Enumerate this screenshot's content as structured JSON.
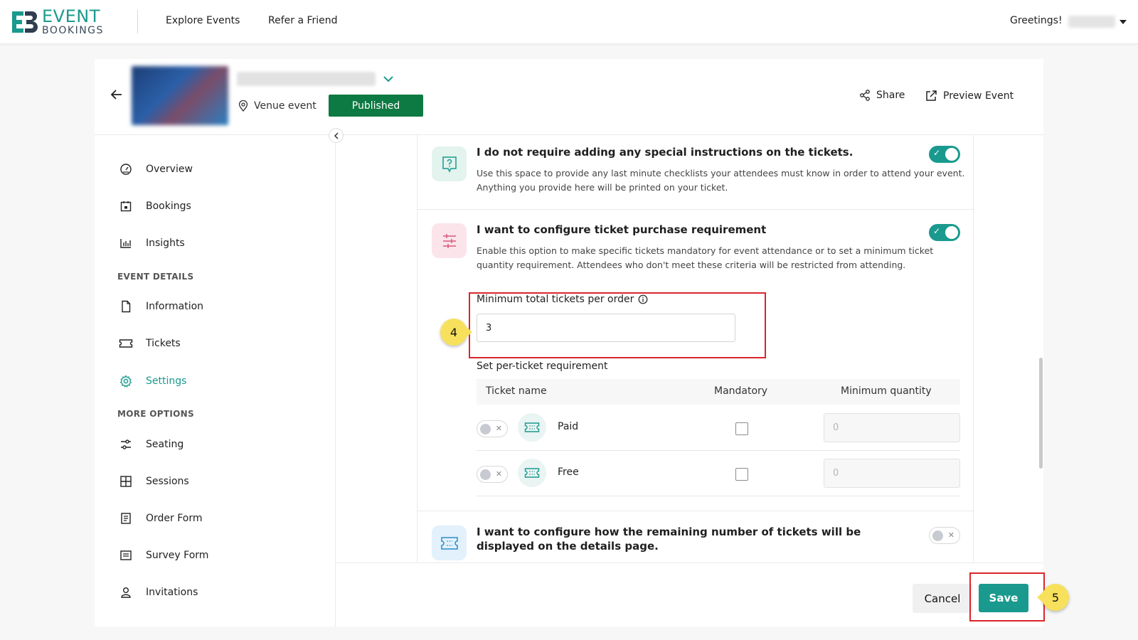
{
  "app": {
    "logo_line1": "EVENT",
    "logo_line2": "BOOKINGS"
  },
  "nav": {
    "explore": "Explore Events",
    "refer": "Refer a Friend",
    "greeting": "Greetings!"
  },
  "event": {
    "venue_type": "Venue event",
    "status": "Published",
    "share": "Share",
    "preview": "Preview Event"
  },
  "sidebar": {
    "items": [
      {
        "label": "Overview",
        "icon": "gauge-icon"
      },
      {
        "label": "Bookings",
        "icon": "calendar-icon"
      },
      {
        "label": "Insights",
        "icon": "bar-chart-icon"
      }
    ],
    "event_details_heading": "EVENT DETAILS",
    "event_details": [
      {
        "label": "Information",
        "icon": "document-icon"
      },
      {
        "label": "Tickets",
        "icon": "ticket-icon"
      },
      {
        "label": "Settings",
        "icon": "gear-icon",
        "active": true
      }
    ],
    "more_options_heading": "MORE OPTIONS",
    "more_options": [
      {
        "label": "Seating",
        "icon": "sliders-icon"
      },
      {
        "label": "Sessions",
        "icon": "grid-icon"
      },
      {
        "label": "Order Form",
        "icon": "form-icon"
      },
      {
        "label": "Survey Form",
        "icon": "survey-icon"
      },
      {
        "label": "Invitations",
        "icon": "person-icon"
      }
    ]
  },
  "settings": {
    "instructions": {
      "title": "I do not require adding any special instructions on the tickets.",
      "desc": "Use this space to provide any last minute checklists your attendees must know in order to attend your event. Anything you provide here will be printed on your ticket.",
      "enabled": true
    },
    "purchase_req": {
      "title": "I want to configure ticket purchase requirement",
      "desc": "Enable this option to make specific tickets mandatory for event attendance or to set a minimum ticket quantity requirement. Attendees who don't meet these criteria will be restricted from attending.",
      "enabled": true,
      "min_label": "Minimum total tickets per order",
      "min_value": "3",
      "per_ticket_label": "Set per-ticket requirement",
      "columns": [
        "Ticket name",
        "Mandatory",
        "Minimum quantity"
      ],
      "tickets": [
        {
          "name": "Paid",
          "enabled": false,
          "mandatory": false,
          "min_qty_placeholder": "0"
        },
        {
          "name": "Free",
          "enabled": false,
          "mandatory": false,
          "min_qty_placeholder": "0"
        }
      ]
    },
    "remaining": {
      "title": "I want to configure how the remaining number of tickets will be displayed on the details page.",
      "enabled": false
    }
  },
  "footer": {
    "cancel": "Cancel",
    "save": "Save"
  },
  "callouts": {
    "step4": "4",
    "step5": "5"
  },
  "colors": {
    "brand": "#1a9a8e",
    "published": "#0d7a43",
    "highlight": "#d9262c",
    "callout": "#f7e15c"
  }
}
